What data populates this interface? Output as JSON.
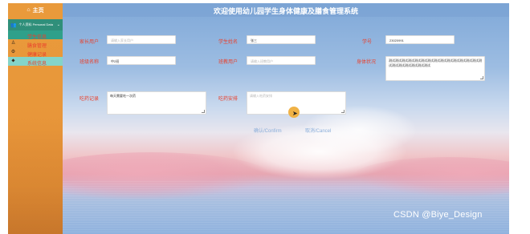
{
  "sidebar": {
    "brand": "主页",
    "user_label": "个人资料 Personal Data",
    "items": [
      {
        "label": "学生信息",
        "icon": "student-icon"
      },
      {
        "label": "膳食管理",
        "icon": "person-icon"
      },
      {
        "label": "健康记录",
        "icon": "settings-icon"
      },
      {
        "label": "系统信息",
        "icon": "tag-icon"
      }
    ]
  },
  "header": {
    "title": "欢迎使用幼儿园学生身体健康及膳食管理系统"
  },
  "form": {
    "row1": {
      "parent_account_label": "家长用户",
      "parent_account_placeholder": "请输入家长用户",
      "student_name_label": "学生姓名",
      "student_name_value": "张三",
      "student_id_label": "学号",
      "student_id_value": "23020991"
    },
    "row2": {
      "class_name_label": "班级名称",
      "class_name_value": "中2班",
      "teacher_account_label": "班教用户",
      "teacher_account_placeholder": "请输入班教用户",
      "body_condition_label": "身体状况",
      "body_condition_value": "测试测试测试测试测试测试测试测试测试测试测试测试测试测试测试测试测试测试测试测试测试"
    },
    "row3": {
      "medication_label": "吃药记录",
      "medication_value": "每天需要吃一次药",
      "medication_plan_label": "吃药安排",
      "medication_plan_placeholder": "请输入吃药安排"
    },
    "confirm_label": "确认/Confirm",
    "cancel_label": "取消/Cancel"
  },
  "watermark": "CSDN @Biye_Design"
}
